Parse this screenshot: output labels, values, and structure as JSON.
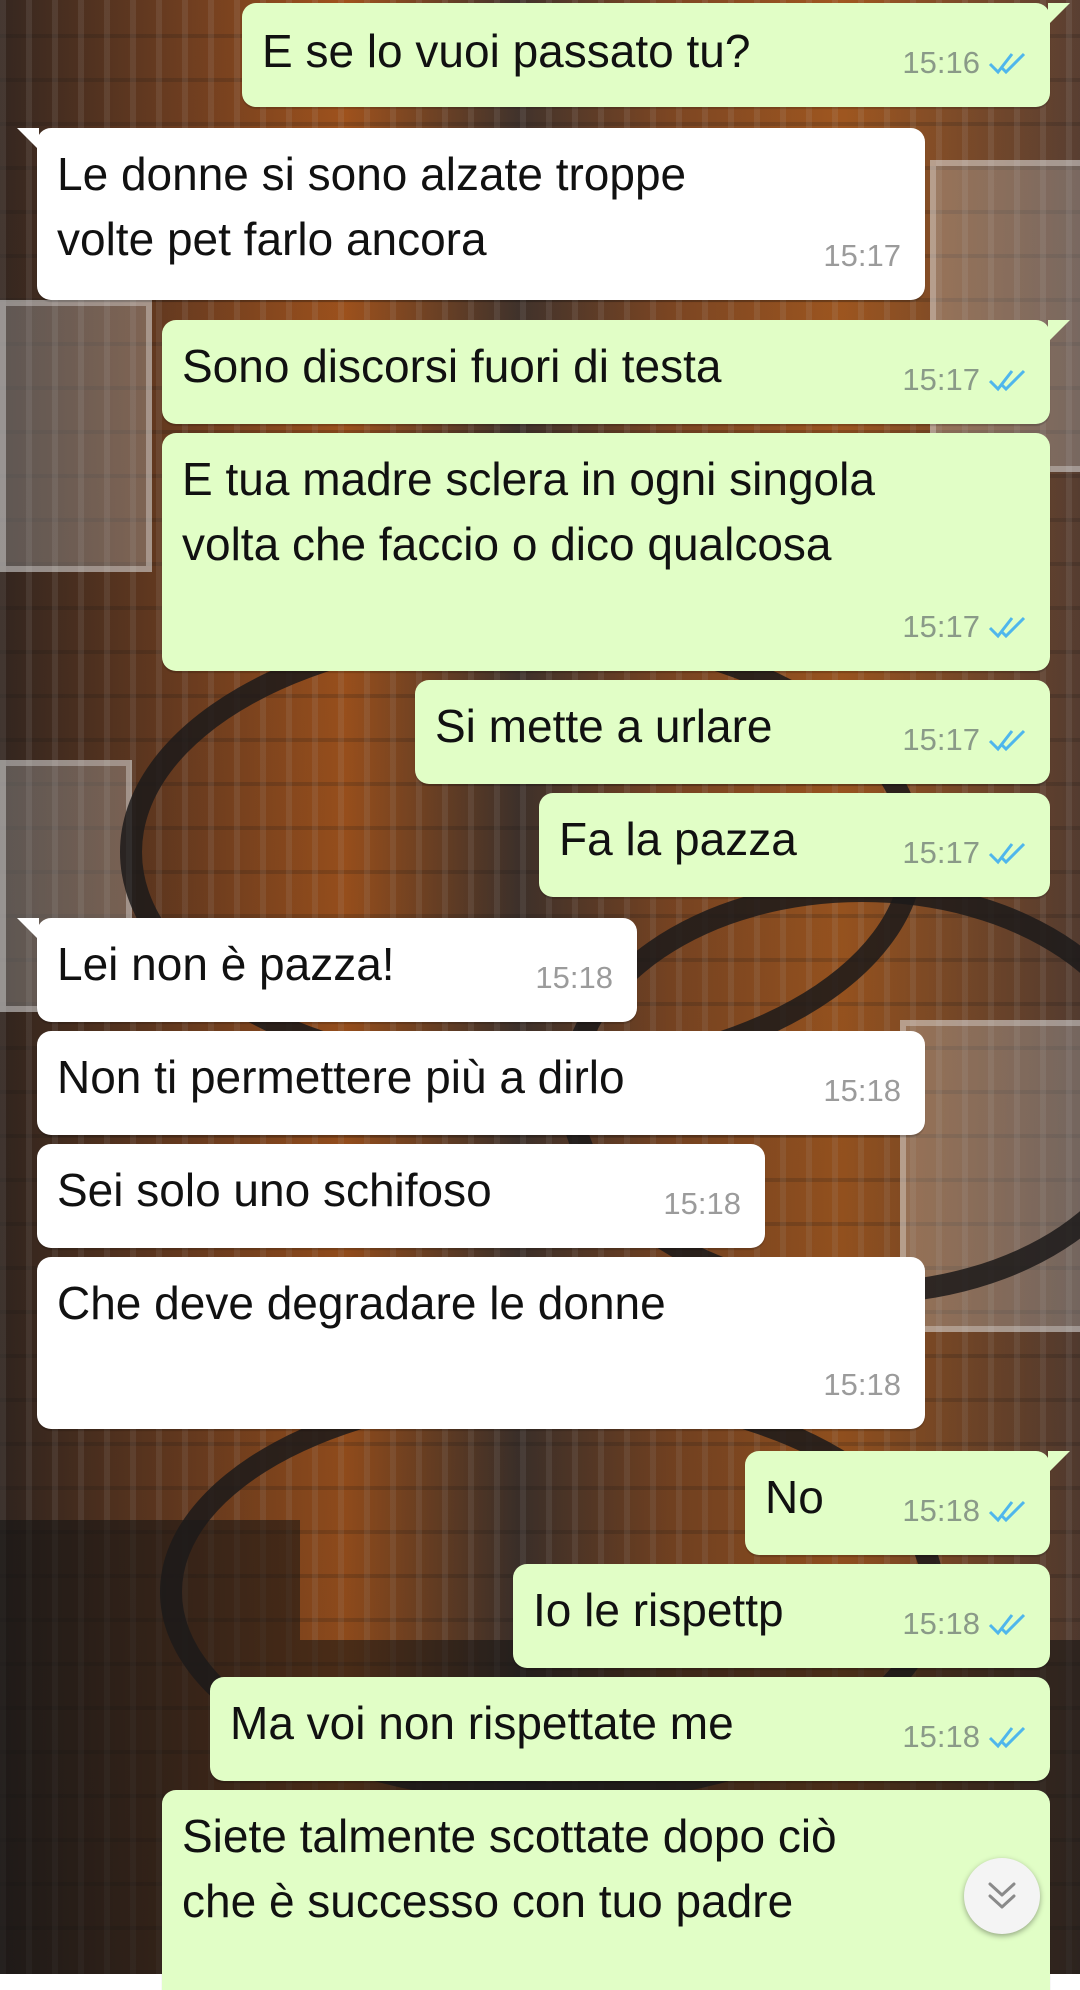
{
  "messages": [
    {
      "dir": "out",
      "text": "E se lo vuoi passato tu?",
      "time": "15:16",
      "ticks": "double-check-icon"
    },
    {
      "dir": "in",
      "text": "Le donne si sono alzate troppe\nvolte pet farlo ancora",
      "time": "15:17"
    },
    {
      "dir": "out",
      "text": "Sono discorsi fuori di testa",
      "time": "15:17",
      "ticks": "double-check-icon"
    },
    {
      "dir": "out",
      "text": "E tua madre sclera in ogni singola\nvolta che faccio o dico qualcosa",
      "time": "15:17",
      "ticks": "double-check-icon"
    },
    {
      "dir": "out",
      "text": "Si mette a urlare",
      "time": "15:17",
      "ticks": "double-check-icon"
    },
    {
      "dir": "out",
      "text": "Fa la pazza",
      "time": "15:17",
      "ticks": "double-check-icon"
    },
    {
      "dir": "in",
      "text": "Lei non è pazza!",
      "time": "15:18"
    },
    {
      "dir": "in",
      "text": "Non ti permettere più a dirlo",
      "time": "15:18"
    },
    {
      "dir": "in",
      "text": "Sei solo uno schifoso",
      "time": "15:18"
    },
    {
      "dir": "in",
      "text": "Che deve degradare le donne",
      "time": "15:18"
    },
    {
      "dir": "out",
      "text": "No",
      "time": "15:18",
      "ticks": "double-check-icon"
    },
    {
      "dir": "out",
      "text": "Io le rispettp",
      "time": "15:18",
      "ticks": "double-check-icon"
    },
    {
      "dir": "out",
      "text": "Ma voi non rispettate me",
      "time": "15:18",
      "ticks": "double-check-icon"
    },
    {
      "dir": "out",
      "text": "Siete talmente scottate dopo ciò\nche è successo con tuo padre",
      "time": ""
    }
  ],
  "scroll_button": {
    "icon": "chevron-double-down-icon"
  },
  "colors": {
    "outgoing_bubble": "#e1fec6",
    "incoming_bubble": "#ffffff",
    "read_tick": "#4fb6ec",
    "timestamp": "#8a9a88"
  }
}
